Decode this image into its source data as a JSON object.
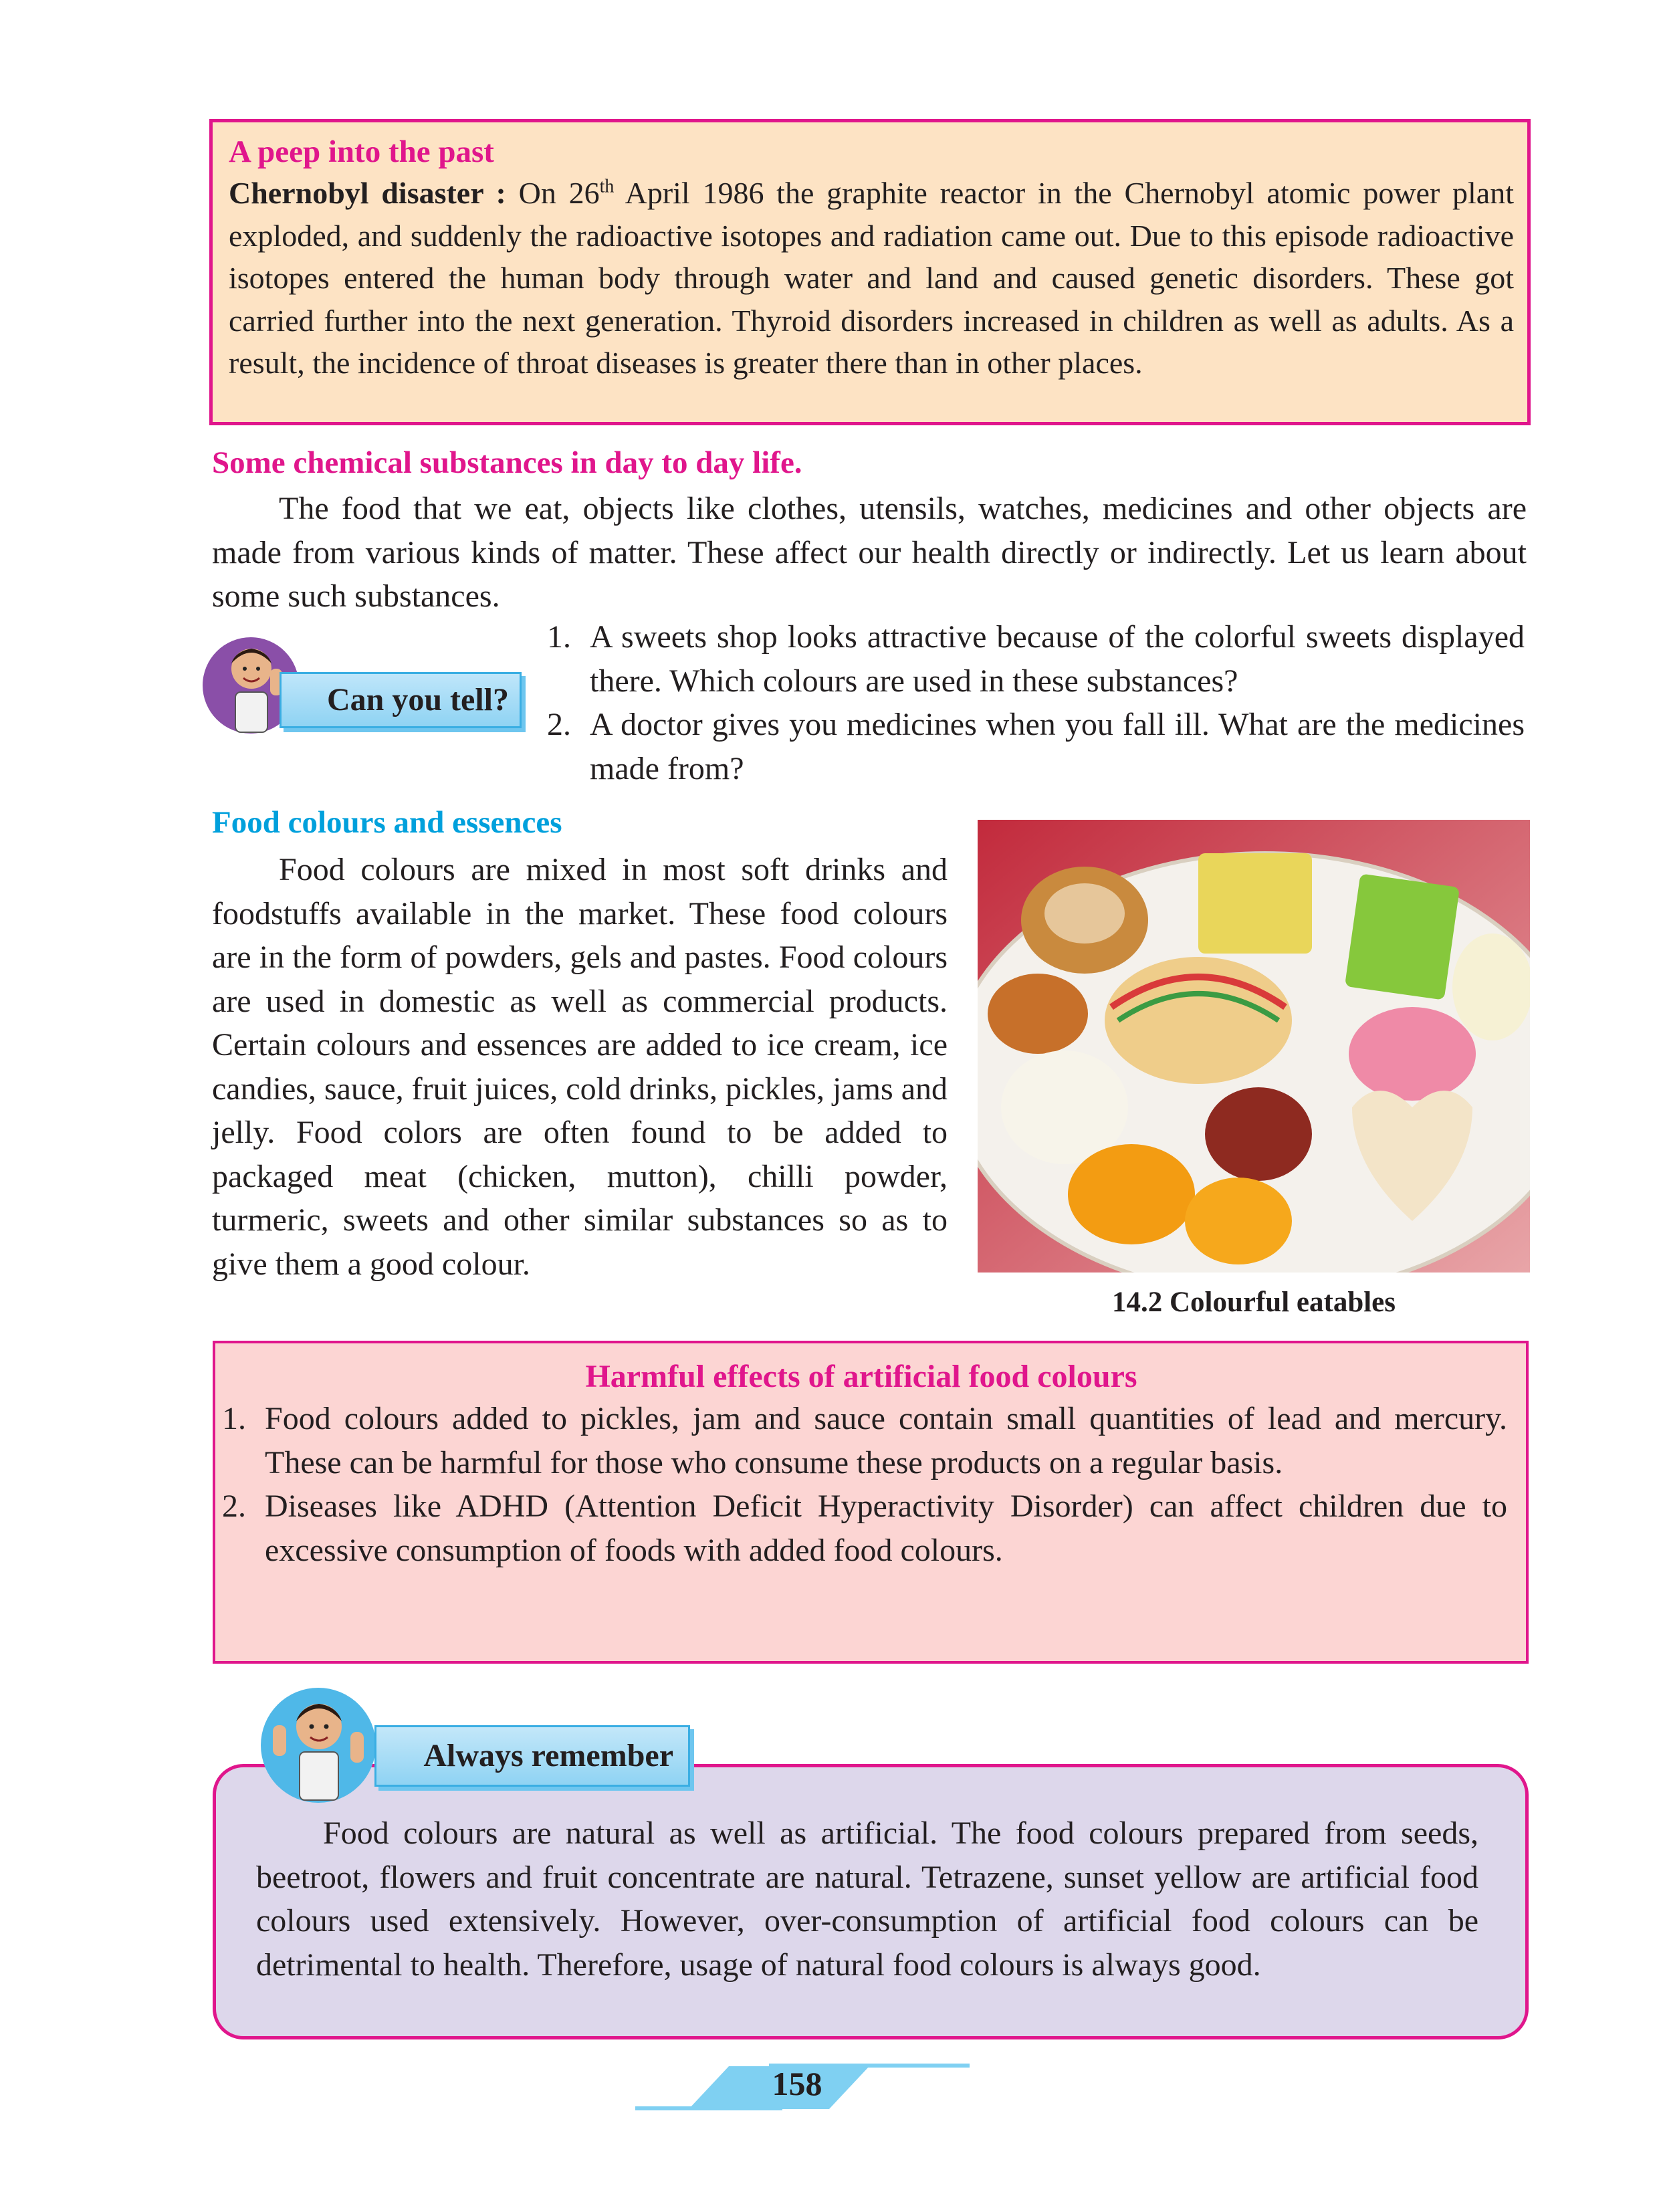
{
  "peep": {
    "title": "A peep into the past",
    "lead": "Chernobyl disaster :",
    "text_before_sup": " On 26",
    "sup": "th",
    "text_after_sup": " April 1986 the graphite reactor in the Chernobyl atomic power plant exploded, and suddenly the radioactive isotopes and radiation came out. Due to this episode radioactive isotopes entered the human body through water and land and caused genetic disorders. These got carried further into the next generation. Thyroid disorders increased in children as well as adults. As a result, the incidence of throat diseases is greater there than in other places."
  },
  "chemicals": {
    "heading": "Some chemical substances in day to day life.",
    "paragraph": "The food that we eat, objects like clothes, utensils, watches, medicines and other objects are made from various kinds of matter. These affect our health directly or indirectly. Let us learn about some such substances."
  },
  "can_you_tell": {
    "badge": "Can you tell?",
    "items": [
      {
        "num": "1.",
        "text": "A sweets shop looks attractive because of the colorful sweets displayed there. Which colours are used in these substances?"
      },
      {
        "num": "2.",
        "text": "A doctor gives you medicines when you fall ill. What are the medicines made from?"
      }
    ]
  },
  "food_colours": {
    "heading": "Food colours and essences",
    "paragraph": "Food colours are mixed in most soft drinks and foodstuffs available in the market. These food colours are in the form of powders, gels and pastes. Food colours are used in domestic as well as commercial products. Certain colours and essences are added to ice cream, ice candies, sauce, fruit juices, cold drinks, pickles, jams and jelly. Food colors are often found to be added to packaged meat (chicken, mutton), chilli powder, turmeric, sweets and other similar substances so as to give them a good colour."
  },
  "figure": {
    "caption": "14.2 Colourful eatables"
  },
  "harmful": {
    "title": "Harmful effects of artificial food colours",
    "items": [
      {
        "num": "1.",
        "text": "Food colours added to pickles, jam and sauce contain small quantities of lead and mercury. These can be harmful for those who consume these products on a regular basis."
      },
      {
        "num": "2.",
        "text": "Diseases like ADHD (Attention Deficit Hyperactivity Disorder) can affect children due to excessive  consumption of foods with added food colours."
      }
    ]
  },
  "remember": {
    "badge": "Always remember",
    "text": "Food colours are natural as well as artificial. The food colours prepared from seeds, beetroot, flowers and fruit concentrate are natural. Tetrazene, sunset yellow are artificial food colours used extensively. However, over-consumption of artificial food colours can be detrimental to health. Therefore, usage of natural food colours is always good."
  },
  "page_number": "158",
  "colors": {
    "accent_pink": "#e0168c",
    "accent_blue": "#00a0dc",
    "peep_bg": "#fde3c4",
    "harm_bg": "#fcd5d3",
    "remember_bg": "#ddd7eb"
  }
}
